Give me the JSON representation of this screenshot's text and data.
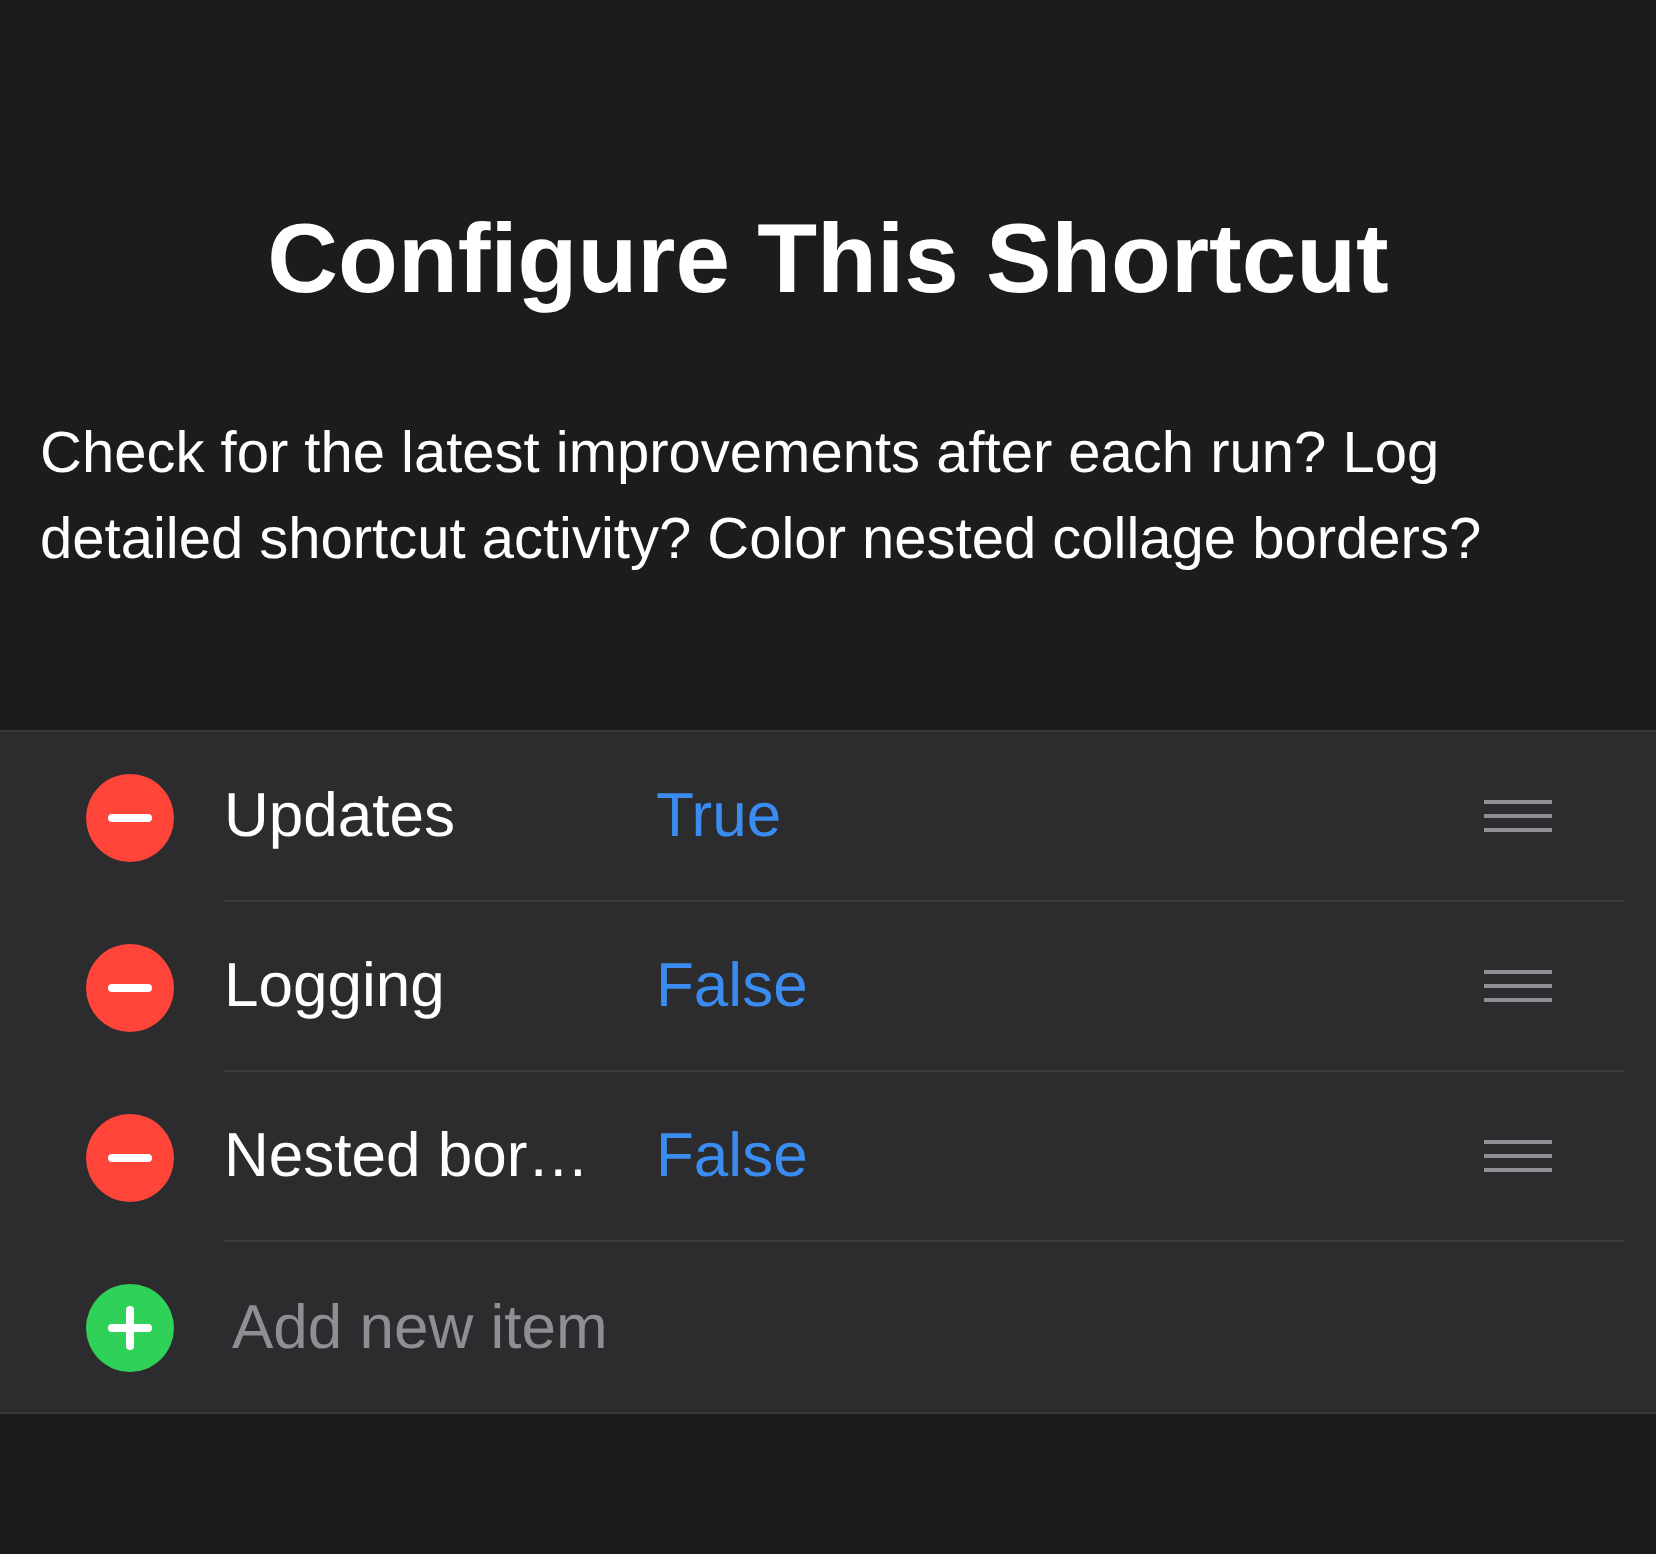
{
  "title": "Configure This Shortcut",
  "description": "Check for the latest improvements after each run? Log detailed shortcut activity? Color nested collage borders?",
  "items": [
    {
      "label": "Updates",
      "value": "True"
    },
    {
      "label": "Logging",
      "value": "False"
    },
    {
      "label": "Nested bor…",
      "value": "False"
    }
  ],
  "add_item": {
    "label": "Add new item"
  }
}
